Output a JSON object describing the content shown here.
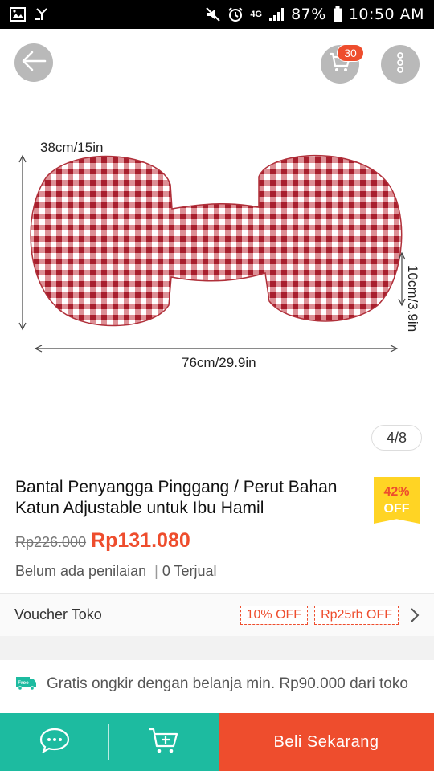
{
  "status_bar": {
    "network": "4G",
    "battery": "87%",
    "time": "10:50 AM"
  },
  "header": {
    "cart_badge_count": "30"
  },
  "gallery": {
    "dim_top": "38cm/15in",
    "dim_side": "10cm/3.9in",
    "dim_bottom": "76cm/29.9in",
    "counter": "4/8"
  },
  "product": {
    "title": "Bantal Penyangga Pinggang / Perut Bahan Katun Adjustable untuk Ibu Hamil",
    "discount_percent": "42%",
    "discount_label": "OFF",
    "original_price": "Rp226.000",
    "price": "Rp131.080",
    "rating_text": "Belum ada penilaian",
    "sold_text": "0 Terjual",
    "sold_separator": "|"
  },
  "voucher": {
    "label": "Voucher Toko",
    "tags": [
      "10% OFF",
      "Rp25rb OFF"
    ]
  },
  "shipping": {
    "icon_text": "Free",
    "text": "Gratis ongkir dengan belanja min. Rp90.000 dari toko"
  },
  "bottom_bar": {
    "buy_now": "Beli Sekarang"
  },
  "colors": {
    "accent": "#ee4d2d",
    "teal": "#1dbba0",
    "badge_yellow": "#ffd424"
  }
}
